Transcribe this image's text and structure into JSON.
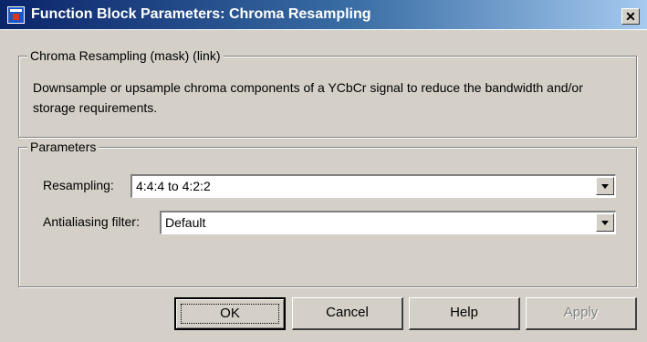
{
  "window": {
    "title": "Function Block Parameters: Chroma Resampling",
    "close_label": "✕"
  },
  "description": {
    "group_title": "Chroma Resampling (mask) (link)",
    "text": "Downsample or upsample chroma components of a YCbCr signal to reduce the bandwidth and/or storage requirements."
  },
  "parameters": {
    "group_title": "Parameters",
    "resampling": {
      "label": "Resampling:",
      "value": "4:4:4 to 4:2:2"
    },
    "antialiasing": {
      "label": "Antialiasing filter:",
      "value": "Default"
    }
  },
  "buttons": {
    "ok": "OK",
    "cancel": "Cancel",
    "help": "Help",
    "apply": "Apply"
  },
  "colors": {
    "title_start": "#0a246a",
    "title_end": "#a6caf0",
    "dialog_bg": "#d4d0c8"
  }
}
